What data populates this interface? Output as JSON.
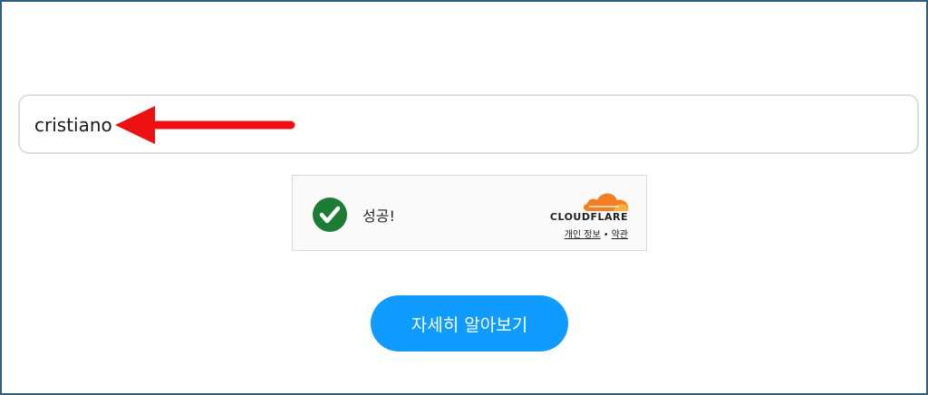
{
  "search": {
    "value": "cristiano"
  },
  "turnstile": {
    "status_text": "성공!",
    "brand": "CLOUDFLARE",
    "privacy_link": "개인 정보",
    "separator": "•",
    "terms_link": "약관"
  },
  "cta": {
    "label": "자세히 알아보기"
  },
  "colors": {
    "accent_blue": "#0f9bff",
    "success_green": "#1b7c34",
    "arrow_red": "#ee1111",
    "cloudflare_orange": "#f38020"
  },
  "icons": {
    "arrow": "arrow-left-icon",
    "check": "check-circle-icon",
    "cloud": "cloudflare-cloud-icon"
  }
}
